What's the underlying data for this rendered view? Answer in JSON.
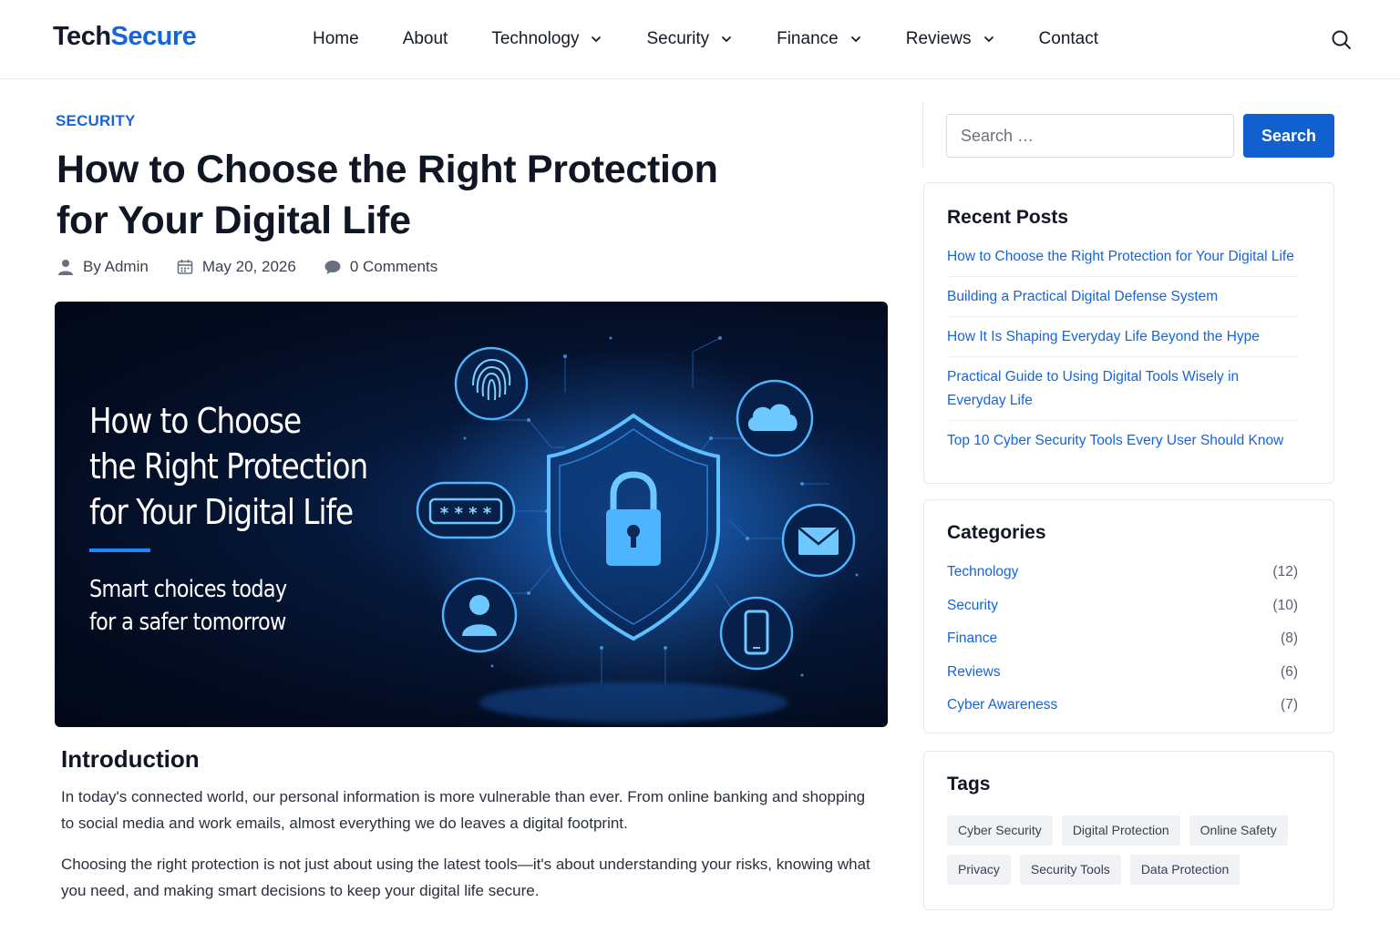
{
  "header": {
    "logo_part1": "Tech",
    "logo_part2": "Secure",
    "nav": [
      {
        "label": "Home",
        "dropdown": false
      },
      {
        "label": "About",
        "dropdown": false
      },
      {
        "label": "Technology",
        "dropdown": true
      },
      {
        "label": "Security",
        "dropdown": true
      },
      {
        "label": "Finance",
        "dropdown": true
      },
      {
        "label": "Reviews",
        "dropdown": true
      },
      {
        "label": "Contact",
        "dropdown": false
      }
    ],
    "search_icon": "search-icon"
  },
  "article": {
    "category": "SECURITY",
    "title": "How to Choose the Right Protection for Your Digital Life",
    "meta": {
      "author": "By Admin",
      "date": "May 20, 2026",
      "comments": "0 Comments"
    },
    "hero": {
      "title_lines": [
        "How to Choose",
        "the Right Protection",
        "for Your Digital Life"
      ],
      "subtitle_lines": [
        "Smart choices today",
        "for a safer tomorrow"
      ],
      "icons": [
        "fingerprint-icon",
        "cloud-icon",
        "password-icon",
        "lock-shield-icon",
        "email-icon",
        "user-icon",
        "phone-icon"
      ]
    },
    "intro_heading": "Introduction",
    "paragraphs": [
      "In today's connected world, our personal information is more vulnerable than ever. From online banking and shopping to social media and work emails, almost everything we do leaves a digital footprint.",
      "Choosing the right protection is not just about using the latest tools—it's about understanding your risks, knowing what you need, and making smart decisions to keep your digital life secure."
    ]
  },
  "sidebar": {
    "search": {
      "placeholder": "Search …",
      "button": "Search"
    },
    "recent": {
      "heading": "Recent Posts",
      "items": [
        "How to Choose the Right Protection for Your Digital Life",
        "Building a Practical Digital Defense System",
        "How It Is Shaping Everyday Life Beyond the Hype",
        "Practical Guide to Using Digital Tools Wisely in Everyday Life",
        "Top 10 Cyber Security Tools Every User Should Know"
      ]
    },
    "categories": {
      "heading": "Categories",
      "items": [
        {
          "name": "Technology",
          "count": "(12)"
        },
        {
          "name": "Security",
          "count": "(10)"
        },
        {
          "name": "Finance",
          "count": "(8)"
        },
        {
          "name": "Reviews",
          "count": "(6)"
        },
        {
          "name": "Cyber Awareness",
          "count": "(7)"
        }
      ]
    },
    "tags": {
      "heading": "Tags",
      "items": [
        "Cyber Security",
        "Digital Protection",
        "Online Safety",
        "Privacy",
        "Security Tools",
        "Data Protection"
      ]
    }
  },
  "colors": {
    "accent": "#1565d8",
    "button": "#1060cf",
    "hero_bg": "#030b1f",
    "glow": "#3aa0ff"
  }
}
